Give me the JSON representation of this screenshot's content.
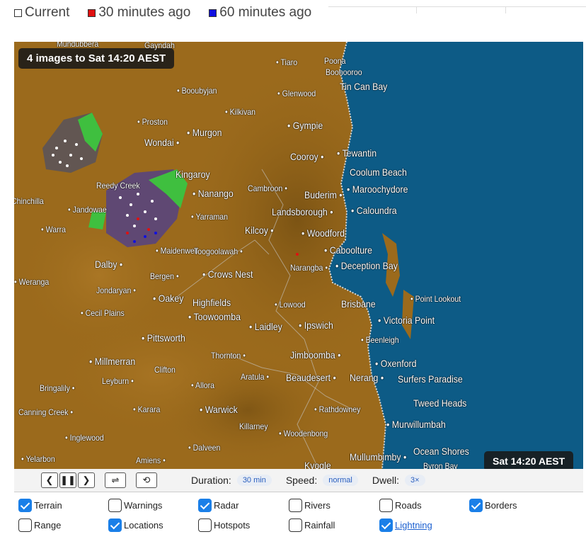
{
  "legend": [
    {
      "label": "Current",
      "color": "#ffffff"
    },
    {
      "label": "30 minutes ago",
      "color": "#e01010"
    },
    {
      "label": "60 minutes ago",
      "color": "#1010e0"
    }
  ],
  "map": {
    "badge_top": "4 images to Sat 14:20 AEST",
    "badge_bottom": "Sat 14:20 AEST",
    "land_color": "#9b6a1c",
    "ocean_color": "#0d5b86",
    "places": [
      "Mundubbera",
      "Gayndah",
      "Tiaro",
      "Poona",
      "Boonooroo",
      "Booubyjan",
      "Glenwood",
      "Tin Can Bay",
      "Kilkivan",
      "Proston",
      "Murgon",
      "Gympie",
      "Wondai",
      "Cooroy",
      "Tewantin",
      "Coolum Beach",
      "Kingaroy",
      "Reedy Creek",
      "Nanango",
      "Cambroon",
      "Buderim",
      "Maroochydore",
      "Chinchilla",
      "Jandowae",
      "Yarraman",
      "Landsborough",
      "Caloundra",
      "Warra",
      "Kilcoy",
      "Woodford",
      "Maidenwell",
      "Toogoolawah",
      "Caboolture",
      "Dalby",
      "Narangba",
      "Deception Bay",
      "Bergen",
      "Crows Nest",
      "Weranga",
      "Jondaryan",
      "Oakey",
      "Highfields",
      "Point Lookout",
      "Lowood",
      "Brisbane",
      "Cecil Plains",
      "Toowoomba",
      "Laidley",
      "Ipswich",
      "Victoria Point",
      "Beenleigh",
      "Pittsworth",
      "Millmerran",
      "Thornton",
      "Jimboomba",
      "Clifton",
      "Oxenford",
      "Leyburn",
      "Aratula",
      "Beaudesert",
      "Nerang",
      "Surfers Paradise",
      "Bringalily",
      "Allora",
      "Tweed Heads",
      "Canning Creek",
      "Karara",
      "Warwick",
      "Rathdowney",
      "Killarney",
      "Murwillumbah",
      "Inglewood",
      "Woodenbong",
      "Dalveen",
      "Ocean Shores",
      "Yelarbon",
      "Amiens",
      "Mullumbimby",
      "Kyogle",
      "Byron Bay"
    ]
  },
  "controls": {
    "duration_label": "Duration:",
    "duration_value": "30 min",
    "speed_label": "Speed:",
    "speed_value": "normal",
    "dwell_label": "Dwell:",
    "dwell_value": "3×",
    "prev": "❮",
    "pause": "❚❚",
    "next": "❯",
    "swap": "⇌",
    "sync": "⟲"
  },
  "options": [
    {
      "label": "Terrain",
      "checked": true
    },
    {
      "label": "Warnings",
      "checked": false
    },
    {
      "label": "Radar",
      "checked": true
    },
    {
      "label": "Rivers",
      "checked": false
    },
    {
      "label": "Roads",
      "checked": false
    },
    {
      "label": "Borders",
      "checked": true
    },
    {
      "label": "Range",
      "checked": false
    },
    {
      "label": "Locations",
      "checked": true
    },
    {
      "label": "Hotspots",
      "checked": false
    },
    {
      "label": "Rainfall",
      "checked": false
    },
    {
      "label": "Lightning",
      "checked": true
    }
  ]
}
